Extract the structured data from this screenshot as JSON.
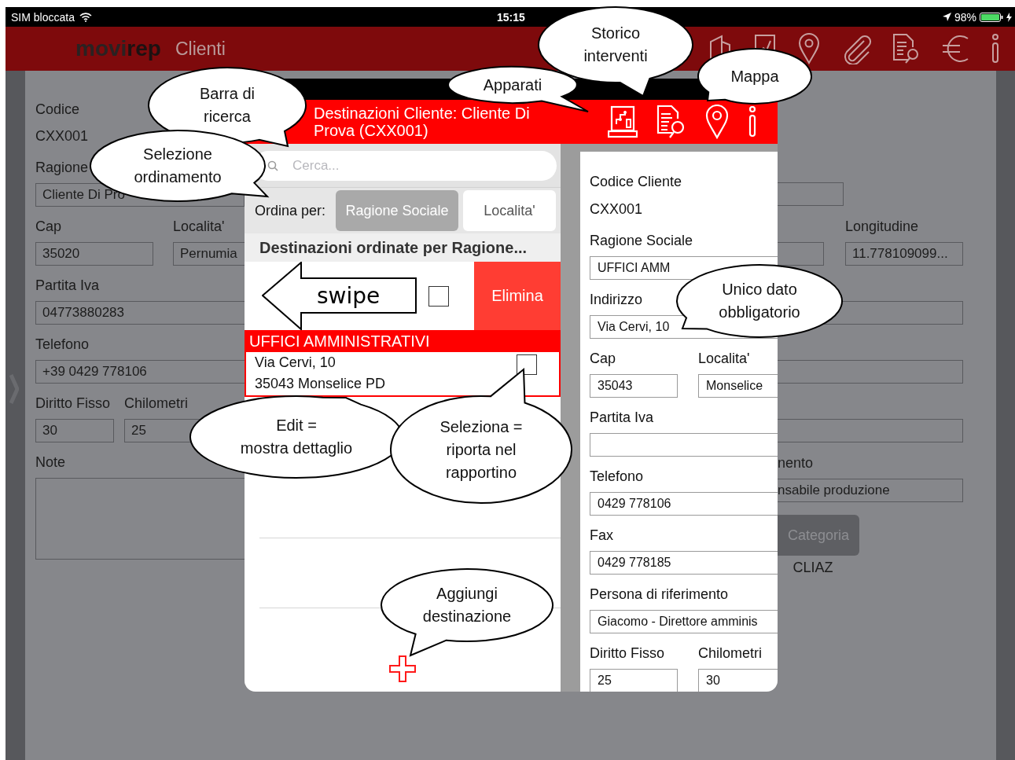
{
  "status_bar": {
    "carrier": "SIM bloccata",
    "time": "15:15",
    "battery": "98%"
  },
  "nav": {
    "logo": [
      "movi",
      "rep"
    ],
    "title": "Clienti"
  },
  "client_form": {
    "codice_label": "Codice",
    "codice": "CXX001",
    "ragione_label": "Ragione",
    "ragione": "Cliente Di Pro",
    "cap_label": "Cap",
    "cap": "35020",
    "localita_label": "Localita'",
    "localita": "Pernumia",
    "piva_label": "Partita Iva",
    "piva": "04773880283",
    "telefono_label": "Telefono",
    "telefono": "+39 0429 778106",
    "diritto_label": "Diritto Fisso",
    "diritto": "30",
    "km_label": "Chilometri",
    "km": "25",
    "note_label": "Note",
    "longitudine_label": "Longitudine",
    "longitudine": "11.778109099...",
    "referente_label": "nento",
    "referente": "nsabile produzione",
    "categoria_button": "Categoria",
    "categoria": "CLIAZ"
  },
  "modal": {
    "title_lines": [
      "Destinazioni Cliente: Cliente Di",
      "Prova (CXX001)"
    ],
    "search": {
      "placeholder": "Cerca..."
    },
    "sort": {
      "label": "Ordina per:",
      "options": [
        {
          "label": "Ragione Sociale",
          "selected": true
        },
        {
          "label": "Localita'",
          "selected": false
        }
      ]
    },
    "section_header": "Destinazioni ordinate per Ragione...",
    "swipe_row": {
      "hint": "swipe",
      "checked": false,
      "delete": "Elimina"
    },
    "destinations": [
      {
        "name": "UFFICI AMMINISTRATIVI",
        "address": "Via Cervi, 10",
        "city": "35043 Monselice PD",
        "checked": false
      }
    ],
    "detail": [
      {
        "kind": "text",
        "label": "Codice Cliente",
        "value": "CXX001"
      },
      {
        "kind": "input",
        "label": "Ragione Sociale",
        "value": "UFFICI AMM"
      },
      {
        "kind": "input",
        "label": "Indirizzo",
        "value": "Via Cervi, 10"
      },
      {
        "kind": "pair",
        "items": [
          {
            "label": "Cap",
            "value": "35043"
          },
          {
            "label": "Localita'",
            "value": "Monselice"
          }
        ]
      },
      {
        "kind": "input",
        "label": "Partita Iva"
      },
      {
        "kind": "input",
        "label": "Telefono",
        "value": "0429 778106"
      },
      {
        "kind": "input",
        "label": "Fax",
        "value": "0429 778185"
      },
      {
        "kind": "input",
        "label": "Persona di riferimento",
        "value": "Giacomo - Direttore amminis"
      },
      {
        "kind": "pair",
        "items": [
          {
            "label": "Diritto Fisso",
            "value": "25"
          },
          {
            "label": "Chilometri",
            "value": "30"
          }
        ]
      }
    ]
  },
  "callouts": [
    {
      "lines": [
        "Storico",
        "interventi"
      ]
    },
    {
      "lines": [
        "Mappa"
      ]
    },
    {
      "lines": [
        "Barra di",
        "ricerca"
      ]
    },
    {
      "lines": [
        "Apparati"
      ]
    },
    {
      "lines": [
        "Selezione",
        "ordinamento"
      ]
    },
    {
      "lines": [
        "Unico dato",
        "obbligatorio"
      ]
    },
    {
      "lines": [
        "Edit =",
        "mostra dettaglio"
      ]
    },
    {
      "lines": [
        "Seleziona =",
        "riporta nel",
        "rapportino"
      ]
    },
    {
      "lines": [
        "Aggiungi",
        "destinazione"
      ]
    }
  ]
}
